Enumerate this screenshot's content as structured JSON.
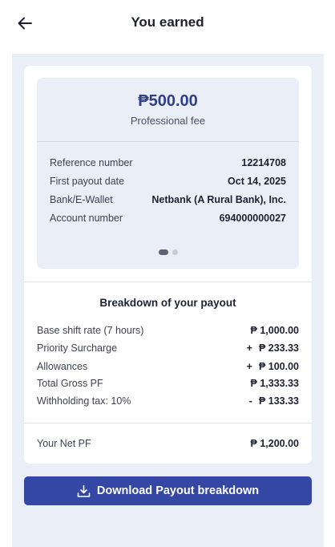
{
  "header": {
    "title": "You earned"
  },
  "payout": {
    "amount": "₱500.00",
    "amount_label": "Professional fee",
    "details": [
      {
        "label": "Reference number",
        "value": "12214708"
      },
      {
        "label": "First payout date",
        "value": "Oct 14, 2025"
      },
      {
        "label": "Bank/E-Wallet",
        "value": "Netbank (A Rural Bank), Inc."
      },
      {
        "label": "Account number",
        "value": "694000000027"
      }
    ],
    "carousel": {
      "total_slides": 2,
      "active_slide": 1
    }
  },
  "breakdown": {
    "title": "Breakdown of your payout",
    "rows": [
      {
        "label": "Base shift rate (7 hours)",
        "sign": "",
        "value": "₱ 1,000.00"
      },
      {
        "label": "Priority Surcharge",
        "sign": "+",
        "value": "₱ 233.33"
      },
      {
        "label": "Allowances",
        "sign": "+",
        "value": "₱ 100.00"
      },
      {
        "label": "Total Gross PF",
        "sign": "",
        "value": "₱ 1,333.33"
      },
      {
        "label": "Withholding tax: 10%",
        "sign": "-",
        "value": "₱ 133.33"
      }
    ],
    "net": {
      "label": "Your Net PF",
      "value": "₱ 1,200.00"
    }
  },
  "download_button": {
    "label": "Download Payout breakdown"
  },
  "colors": {
    "accent": "#3447a5",
    "amount": "#2f3f8c",
    "panel_bg": "#e9eef7"
  },
  "icons": {
    "back": "arrow-left-icon",
    "download": "download-icon"
  }
}
